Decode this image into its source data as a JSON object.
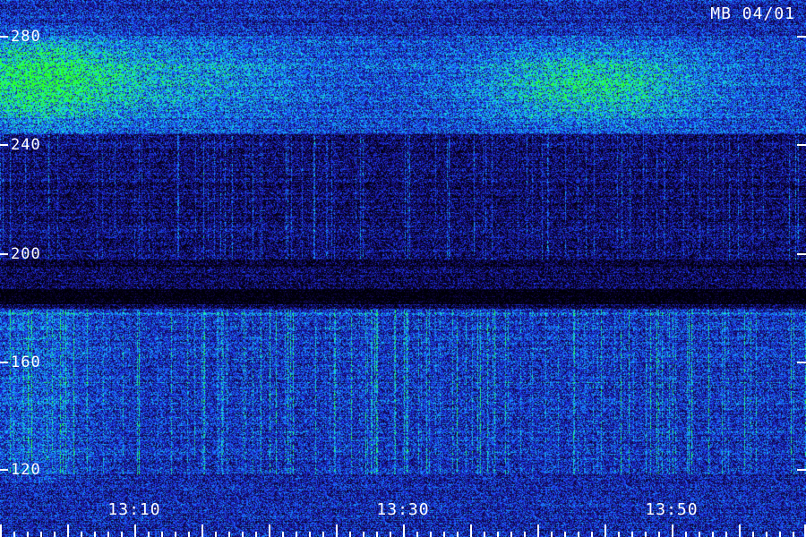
{
  "stamp": "MB 04/01",
  "y_axis": {
    "ticks": [
      {
        "value": 280,
        "label": "280"
      },
      {
        "value": 240,
        "label": "240"
      },
      {
        "value": 200,
        "label": "200"
      },
      {
        "value": 160,
        "label": "160"
      },
      {
        "value": 120,
        "label": "120"
      }
    ]
  },
  "x_axis": {
    "labels": [
      {
        "time": "13:10",
        "label": "13:10"
      },
      {
        "time": "13:30",
        "label": "13:30"
      },
      {
        "time": "13:50",
        "label": "13:50"
      }
    ],
    "major_tick_interval_minutes": 5,
    "minor_tick_interval_minutes": 1
  },
  "palette": {
    "background": "#000000",
    "low": "#1a0a6e",
    "mid": "#1f3cff",
    "high": "#16d8f0",
    "peak": "#22ff33",
    "axis": "#ffffff"
  }
}
